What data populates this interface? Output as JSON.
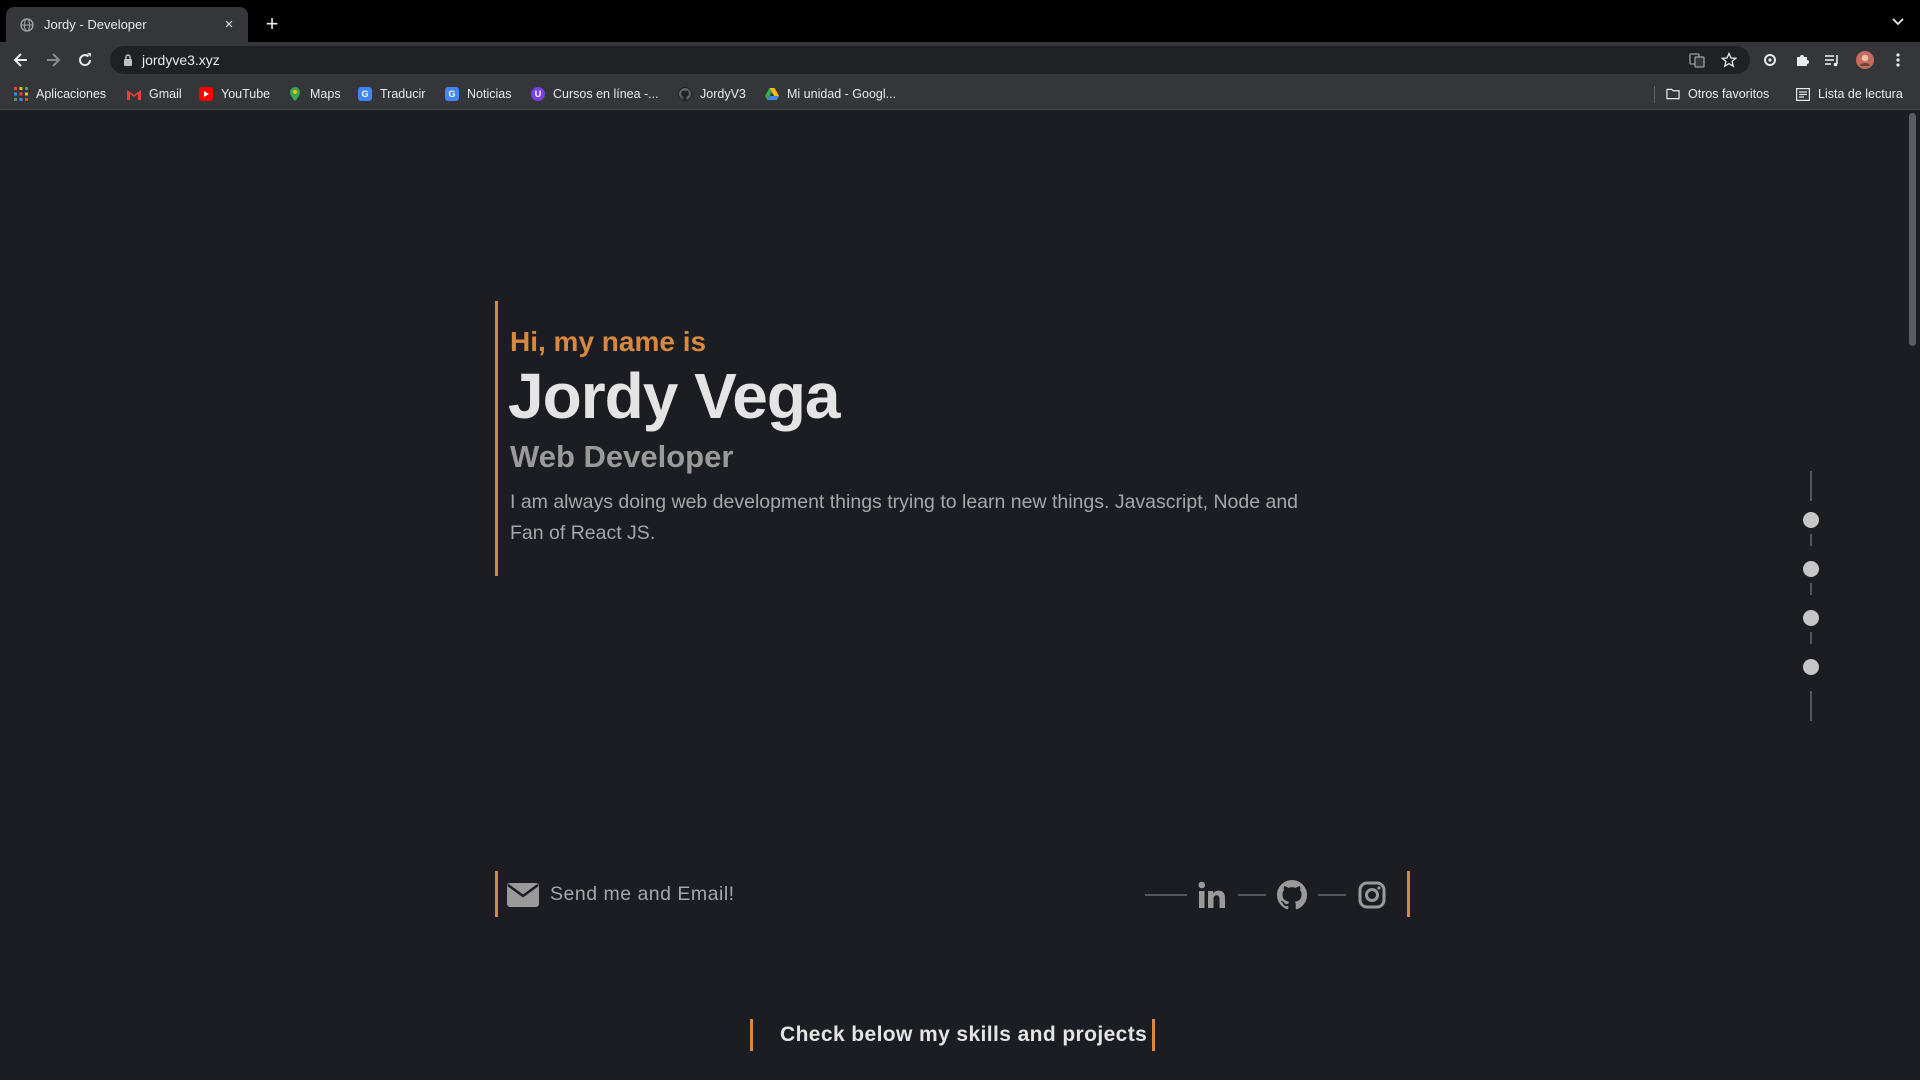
{
  "browser": {
    "tab": {
      "title": "Jordy - Developer",
      "close_symbol": "×"
    },
    "new_tab_symbol": "+",
    "url": "jordyve3.xyz",
    "bookmarks": [
      {
        "label": "Aplicaciones",
        "icon": "apps-grid-icon"
      },
      {
        "label": "Gmail",
        "icon": "gmail-icon"
      },
      {
        "label": "YouTube",
        "icon": "youtube-icon"
      },
      {
        "label": "Maps",
        "icon": "maps-icon"
      },
      {
        "label": "Traducir",
        "icon": "translate-icon"
      },
      {
        "label": "Noticias",
        "icon": "news-icon"
      },
      {
        "label": "Cursos en línea -...",
        "icon": "courses-icon"
      },
      {
        "label": "JordyV3",
        "icon": "github-icon"
      },
      {
        "label": "Mi unidad - Googl...",
        "icon": "drive-icon"
      }
    ],
    "other_bookmarks": "Otros favoritos",
    "reading_list": "Lista de lectura"
  },
  "hero": {
    "greeting": "Hi, my name is",
    "name": "Jordy Vega",
    "role": "Web Developer",
    "bio": "I am always doing web development things trying to learn new things. Javascript, Node and Fan of React JS."
  },
  "contact": {
    "email_label": "Send me and Email!",
    "socials": [
      "linkedin-icon",
      "github-icon",
      "instagram-icon"
    ]
  },
  "cta": {
    "label": "Check below my skills and projects"
  },
  "colors": {
    "accent": "#d9893f",
    "background": "#1b1d22",
    "heading": "#e4e4e4",
    "muted": "#9a9a9a"
  }
}
